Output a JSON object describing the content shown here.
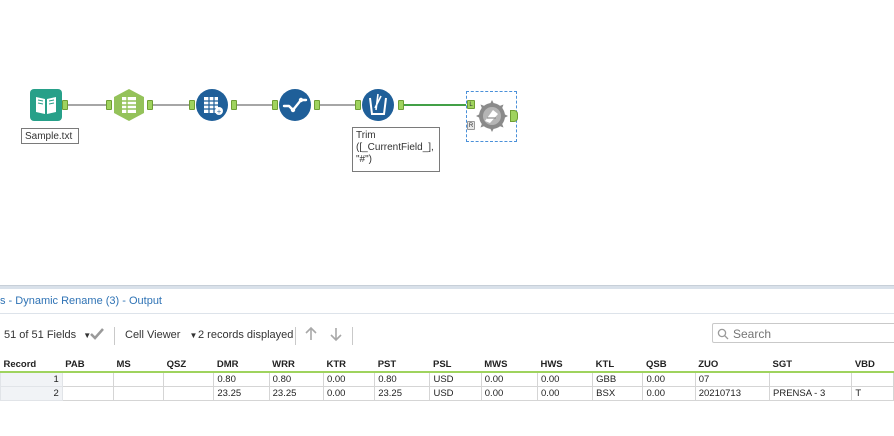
{
  "workflow": {
    "input_label": "Sample.txt",
    "formula_label": "Trim\n([_CurrentField_],\n\"#\")",
    "join_anchor_left": "L",
    "join_anchor_right": "R"
  },
  "results": {
    "title": "s - Dynamic Rename (3) - Output",
    "fields_label": "51 of 51 Fields",
    "cell_viewer_label": "Cell Viewer",
    "records_label": "2 records displayed",
    "search_placeholder": "Search"
  },
  "table": {
    "columns": [
      "Record",
      "PAB",
      "MS",
      "QSZ",
      "DMR",
      "WRR",
      "KTR",
      "PST",
      "PSL",
      "MWS",
      "HWS",
      "KTL",
      "QSB",
      "ZUO",
      "SGT",
      "VBD"
    ],
    "rows": [
      [
        "1",
        "",
        "",
        "",
        "0.80",
        "0.80",
        "0.00",
        "0.80",
        "USD",
        "0.00",
        "0.00",
        "GBB",
        "0.00",
        "07",
        "",
        ""
      ],
      [
        "2",
        "",
        "",
        "",
        "23.25",
        "23.25",
        "0.00",
        "23.25",
        "USD",
        "0.00",
        "0.00",
        "BSX",
        "0.00",
        "20210713",
        "PRENSA - 3",
        "T"
      ]
    ]
  },
  "colors": {
    "accent_blue": "#2f73b5",
    "tool_green": "#94c25a",
    "tool_teal": "#27a089",
    "tool_navy": "#1f5f99",
    "join_gray": "#8a8a8a",
    "anchor_green": "#9fd35e"
  }
}
